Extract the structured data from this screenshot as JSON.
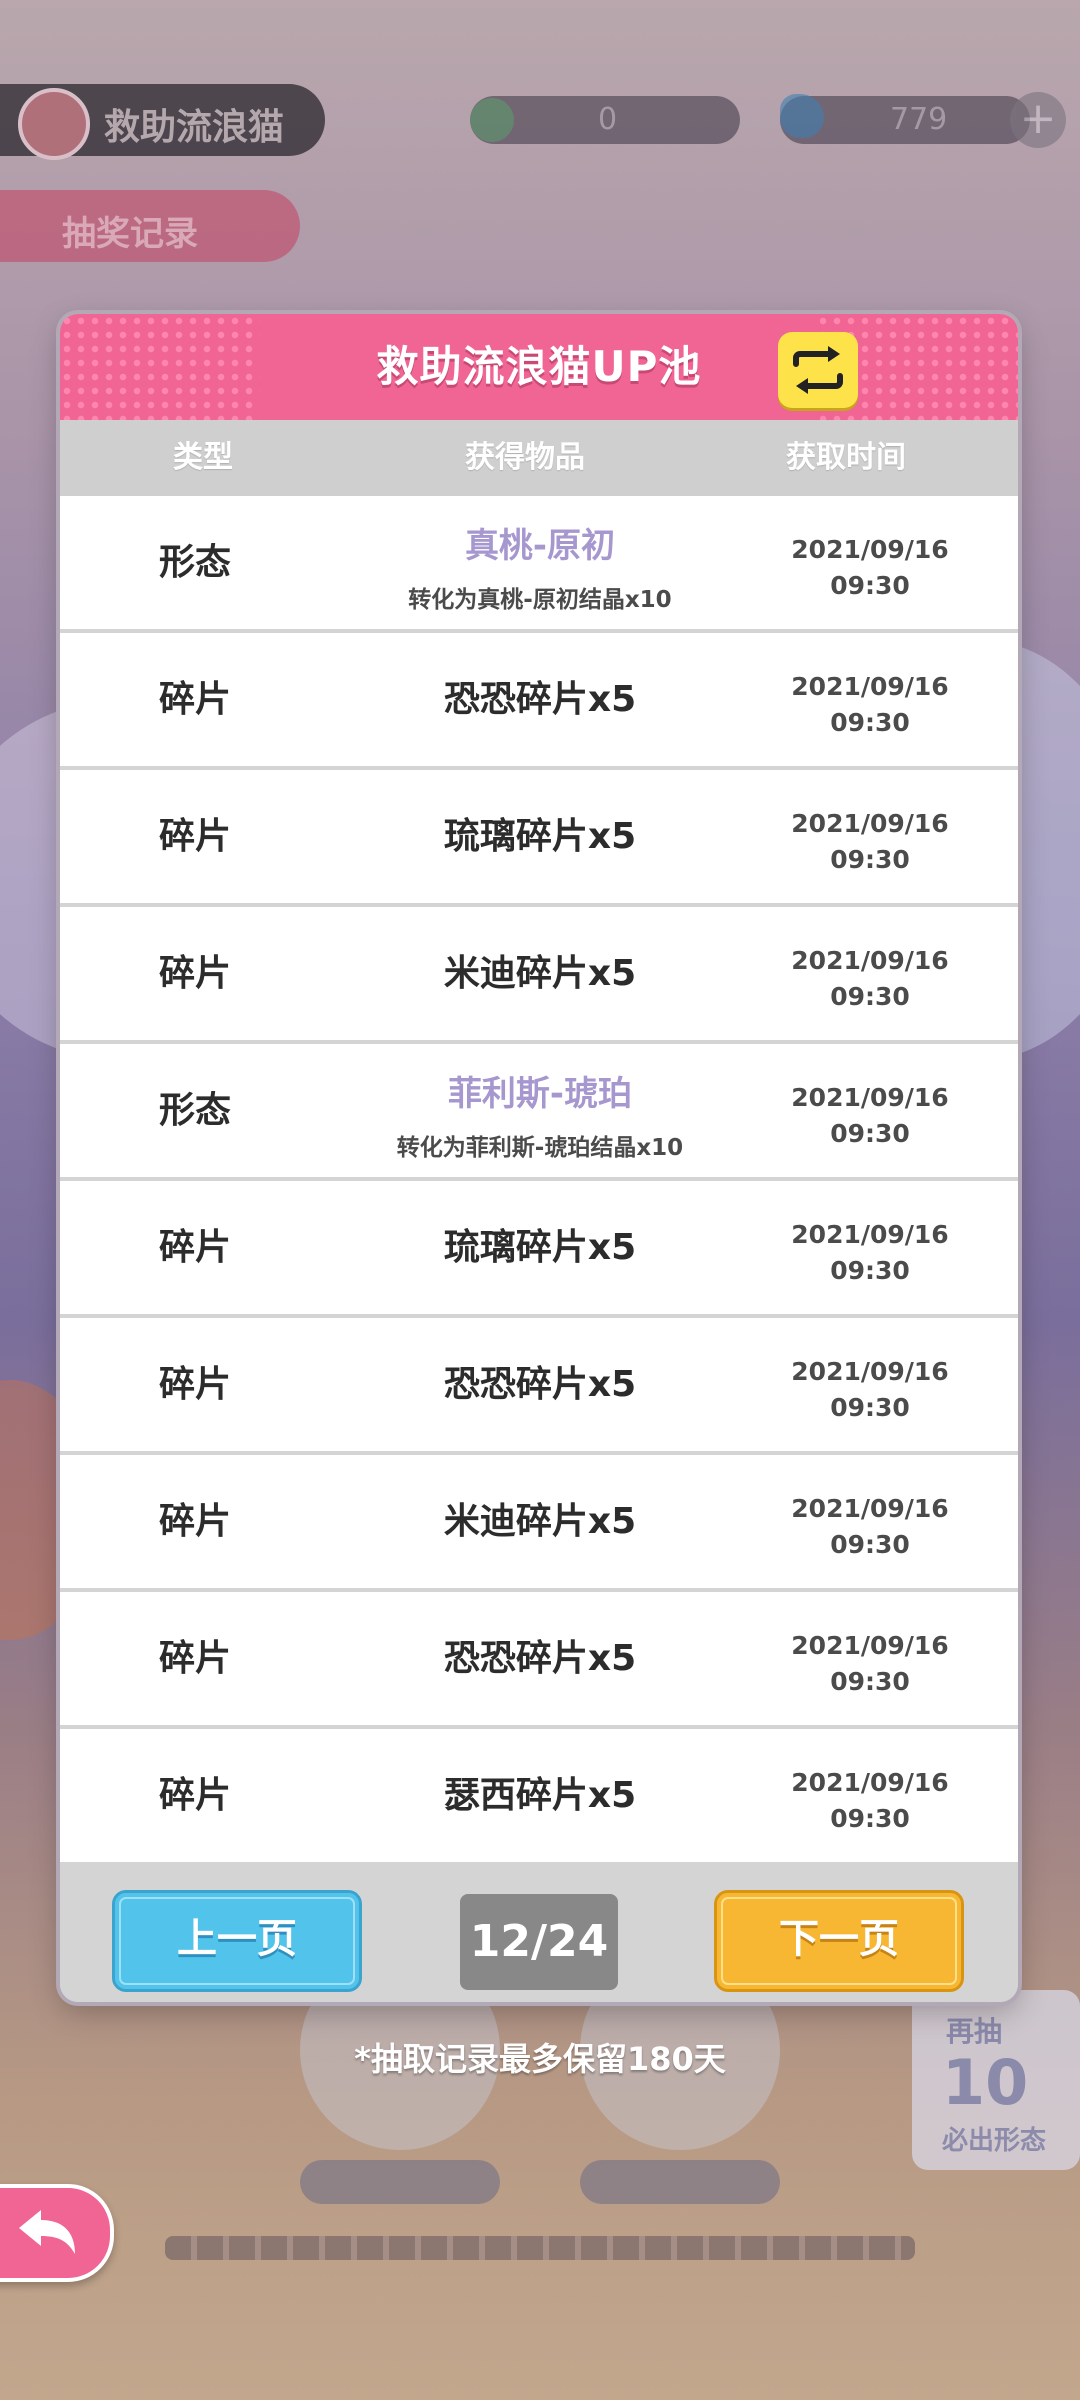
{
  "background": {
    "event_title": "救助流浪猫",
    "currency_a": "0",
    "currency_b": "779",
    "tab_label": "抽奖记录"
  },
  "modal": {
    "title": "救助流浪猫UP池",
    "switch_icon": "swap-arrows-icon",
    "columns": [
      "类型",
      "获得物品",
      "获取时间"
    ],
    "rows": [
      {
        "type": "形态",
        "item": "真桃-原初",
        "sub": "转化为真桃-原初结晶x10",
        "date": "2021/09/16",
        "time": "09:30"
      },
      {
        "type": "碎片",
        "item": "恐恐碎片x5",
        "sub": "",
        "date": "2021/09/16",
        "time": "09:30"
      },
      {
        "type": "碎片",
        "item": "琉璃碎片x5",
        "sub": "",
        "date": "2021/09/16",
        "time": "09:30"
      },
      {
        "type": "碎片",
        "item": "米迪碎片x5",
        "sub": "",
        "date": "2021/09/16",
        "time": "09:30"
      },
      {
        "type": "形态",
        "item": "菲利斯-琥珀",
        "sub": "转化为菲利斯-琥珀结晶x10",
        "date": "2021/09/16",
        "time": "09:30"
      },
      {
        "type": "碎片",
        "item": "琉璃碎片x5",
        "sub": "",
        "date": "2021/09/16",
        "time": "09:30"
      },
      {
        "type": "碎片",
        "item": "恐恐碎片x5",
        "sub": "",
        "date": "2021/09/16",
        "time": "09:30"
      },
      {
        "type": "碎片",
        "item": "米迪碎片x5",
        "sub": "",
        "date": "2021/09/16",
        "time": "09:30"
      },
      {
        "type": "碎片",
        "item": "恐恐碎片x5",
        "sub": "",
        "date": "2021/09/16",
        "time": "09:30"
      },
      {
        "type": "碎片",
        "item": "瑟西碎片x5",
        "sub": "",
        "date": "2021/09/16",
        "time": "09:30"
      }
    ],
    "prev_label": "上一页",
    "next_label": "下一页",
    "page": "12/24"
  },
  "note": "*抽取记录最多保留180天",
  "back_icon": "back-arrow-icon",
  "colors": {
    "header_pink": "#f06593",
    "highlight_purple": "#a697cf",
    "prev_blue": "#52c4ec",
    "next_orange": "#f7b733",
    "switch_yellow": "#fde24a"
  }
}
